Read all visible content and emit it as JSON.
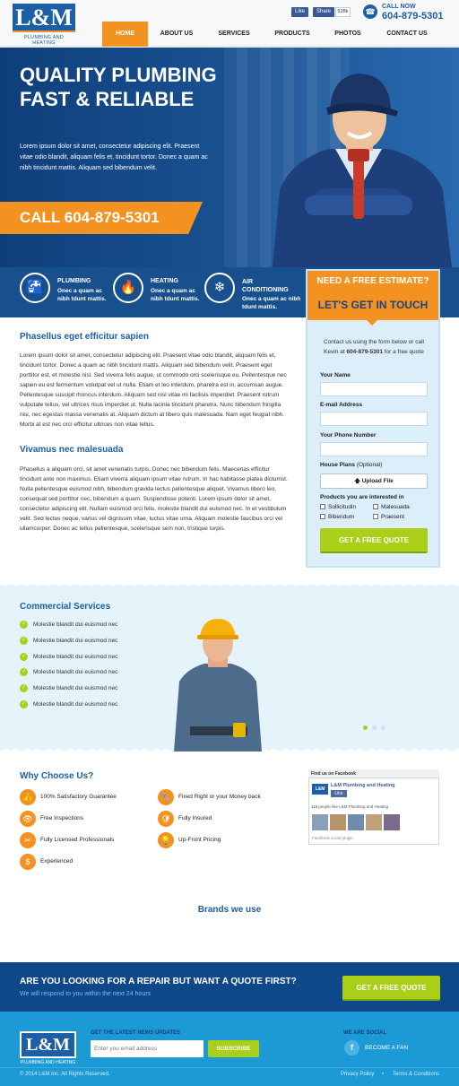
{
  "header": {
    "logo_mark": "L&M",
    "logo_sub": "PLUMBING AND HEATING",
    "fb_like": "Like",
    "fb_share": "Share",
    "fb_count": "528k",
    "call_now": "CALL NOW",
    "phone": "604-879-5301"
  },
  "nav": [
    "HOME",
    "ABOUT US",
    "SERVICES",
    "PRODUCTS",
    "PHOTOS",
    "CONTACT US"
  ],
  "hero": {
    "title": "QUALITY PLUMBING FAST & RELIABLE",
    "text": "Lorem ipsum dolor sit amet, consectetur adipiscing elit. Praesent vitae odio blandit, aliquam felis et, tincidunt tortor. Donec a quam ac nibh tincidunt mattis. Aliquam sed bibendum velit.",
    "cta": "CALL 604-879-5301"
  },
  "services": [
    {
      "icon": "faucet-icon",
      "title": "PLUMBING",
      "desc": "Onec a quam ac nibh tdunt mattis."
    },
    {
      "icon": "flame-icon",
      "title": "HEATING",
      "desc": "Onec a quam ac nibh tdunt mattis."
    },
    {
      "icon": "snowflake-icon",
      "title": "AIR CONDITIONING",
      "desc": "Onec a quam ac nibh tdunt mattis."
    }
  ],
  "estimate": {
    "question": "NEED A FREE ESTIMATE?",
    "heading": "LET'S GET IN TOUCH",
    "intro_pre": "Contact us using the form below or call Kevin at ",
    "intro_phone": "604-879-5301",
    "intro_post": " for a free quote",
    "name_label": "Your Name",
    "email_label": "E-mail Address",
    "phone_label": "Your Phone Number",
    "plans_label": "House Plans",
    "plans_optional": "(Optional)",
    "upload": "Upload File",
    "products_label": "Products you are interested in",
    "products": [
      "Sollicitudin",
      "Malesuada",
      "Bibendum",
      "Praesent"
    ],
    "submit": "GET A FREE QUOTE"
  },
  "main": {
    "h1": "Phasellus eget efficitur sapien",
    "p1": "Lorem ipsum dolor sit amet, consectetur adipiscing elit. Praesent vitae odio blandit, aliquam felis et, tincidunt tortor. Donec a quam ac nibh tincidunt mattis. Aliquam sed bibendum velit. Praesent eget porttitor est, et molestie nisl. Sed viverra felis augue, ut commodo orci scelerisque eu. Pellentesque nec sapien eu est fermentum volutpat vel ut nulla. Etiam et leo interdum, pharetra est in, accumsan augue. Pellentesque suscipit rhoncus interdum. Aliquam sed nisl vitae mi facilisis imperdiet. Praesent rutrum vulputate tellus, vel ultrices risus imperdiet ut. Nulla lacinia tincidunt pharetra. Nunc bibendum fringilla nisi, nec egestas massa venenatis at. Aliquam dictum at libero quis malesuada. Nam eget feugiat nibh. Morbi at est nec orci efficitur ultrices non vitae tellus.",
    "h2": "Vivamus nec malesuada",
    "p2": "Phasellus a aliquam orci, sit amet venenatis turpis. Donec nec bibendum felis. Maecenas efficitur tincidunt ante non maximus. Etiam viverra aliquam ipsum vitae rutrum. In hac habitasse platea dictumst. Nulla pellentesque euismod nibh, bibendum gravida lectus pellentesque aliquet. Vivamus libero leo, consequat sed porttitor nec, bibendum a quam. Suspendisse potenti. Lorem ipsum dolor sit amet, consectetur adipiscing elit. Nullam euismod orci felis, molestie blandit dui euismod nec. In et vestibulum velit. Sed lectus neque, varius vel dignissim vitae, luctus vitae urna. Aliquam molestie faucibus orci vel ullamcorper. Donec ac tellus pellentesque, scelerisque sem non, tristique turpis."
  },
  "commercial": {
    "title": "Commercial Services",
    "items": [
      "Molestie blandit dui euismod nec",
      "Molestie blandit dui euismod nec",
      "Molestie blandit dui euismod nec",
      "Molestie blandit dui euismod nec",
      "Molestie blandit dui euismod nec",
      "Molestie blandit dui euismod nec"
    ]
  },
  "why": {
    "title": "Why Choose Us?",
    "items": [
      {
        "icon": "thumbs-up-icon",
        "text": "100% Satisfactory Guarantee"
      },
      {
        "icon": "wrench-icon",
        "text": "Fixed Right or your Money back"
      },
      {
        "icon": "eye-icon",
        "text": "Free Inspections"
      },
      {
        "icon": "shield-icon",
        "text": "Fully Insured"
      },
      {
        "icon": "tools-icon",
        "text": "Fully Licensed Professionals"
      },
      {
        "icon": "bulb-icon",
        "text": "Up-Front Pricing"
      },
      {
        "icon": "dollar-icon",
        "text": "Experienced"
      }
    ]
  },
  "facebook": {
    "title": "Find us on Facebook",
    "page_name": "L&M Plumbing and Heating",
    "like": "Like",
    "people": "118 people like L&M Plumbing and Heating.",
    "plugin": "Facebook social plugin"
  },
  "brands": "Brands we use",
  "repair": {
    "title": "ARE YOU LOOKING FOR A REPAIR BUT WANT A QUOTE FIRST?",
    "sub": "We will respond to you within the next 24 hours",
    "button": "GET A FREE QUOTE"
  },
  "footer": {
    "logo_mark": "L&M",
    "logo_sub": "PLUMBING AND HEATING",
    "news_title": "GET THE LATEST NEWS UPDATES",
    "email_placeholder": "Enter you email address",
    "subscribe": "SUBSCRIBE",
    "social_title": "WE ARE SOCIAL",
    "fan": "BECOME A FAN",
    "copyright": "© 2014 L&M Inc. All Rights Reserved.",
    "privacy": "Privacy Policy",
    "terms": "Terms & Conditions"
  }
}
